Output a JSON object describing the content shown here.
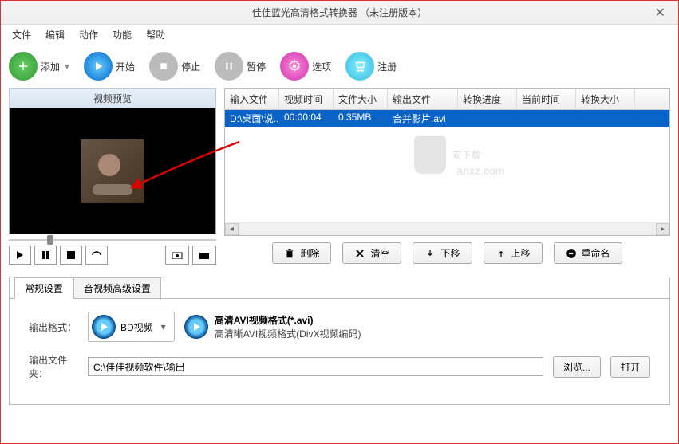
{
  "window": {
    "title": "佳佳蓝光高清格式转换器 （未注册版本）"
  },
  "menu": {
    "file": "文件",
    "edit": "编辑",
    "action": "动作",
    "function": "功能",
    "help": "帮助"
  },
  "toolbar": {
    "add": "添加",
    "start": "开始",
    "stop": "停止",
    "pause": "暂停",
    "options": "选项",
    "register": "注册"
  },
  "preview": {
    "title": "视频预览"
  },
  "table": {
    "headers": {
      "input_file": "输入文件",
      "video_time": "视频时间",
      "file_size": "文件大小",
      "output_file": "输出文件",
      "progress": "转换进度",
      "current_time": "当前时间",
      "size": "转换大小"
    },
    "rows": [
      {
        "input_file": "D:\\桌面\\说...",
        "video_time": "00:00:04",
        "file_size": "0.35MB",
        "output_file": "合并影片.avi",
        "progress": "",
        "current_time": "",
        "size": ""
      }
    ]
  },
  "actions": {
    "delete": "删除",
    "clear": "清空",
    "down": "下移",
    "up": "上移",
    "rename": "重命名"
  },
  "tabs": {
    "general": "常规设置",
    "av": "音视频高级设置"
  },
  "settings": {
    "output_format_label": "输出格式：",
    "format_button": "BD视频",
    "format_title": "高清AVI视频格式(*.avi)",
    "format_desc": "高清晰AVI视频格式(DivX视频编码)",
    "output_folder_label": "输出文件夹：",
    "output_folder_value": "C:\\佳佳视频软件\\输出",
    "browse": "浏览...",
    "open": "打开"
  },
  "watermark": {
    "text": "安下载",
    "sub": "anxz.com"
  }
}
